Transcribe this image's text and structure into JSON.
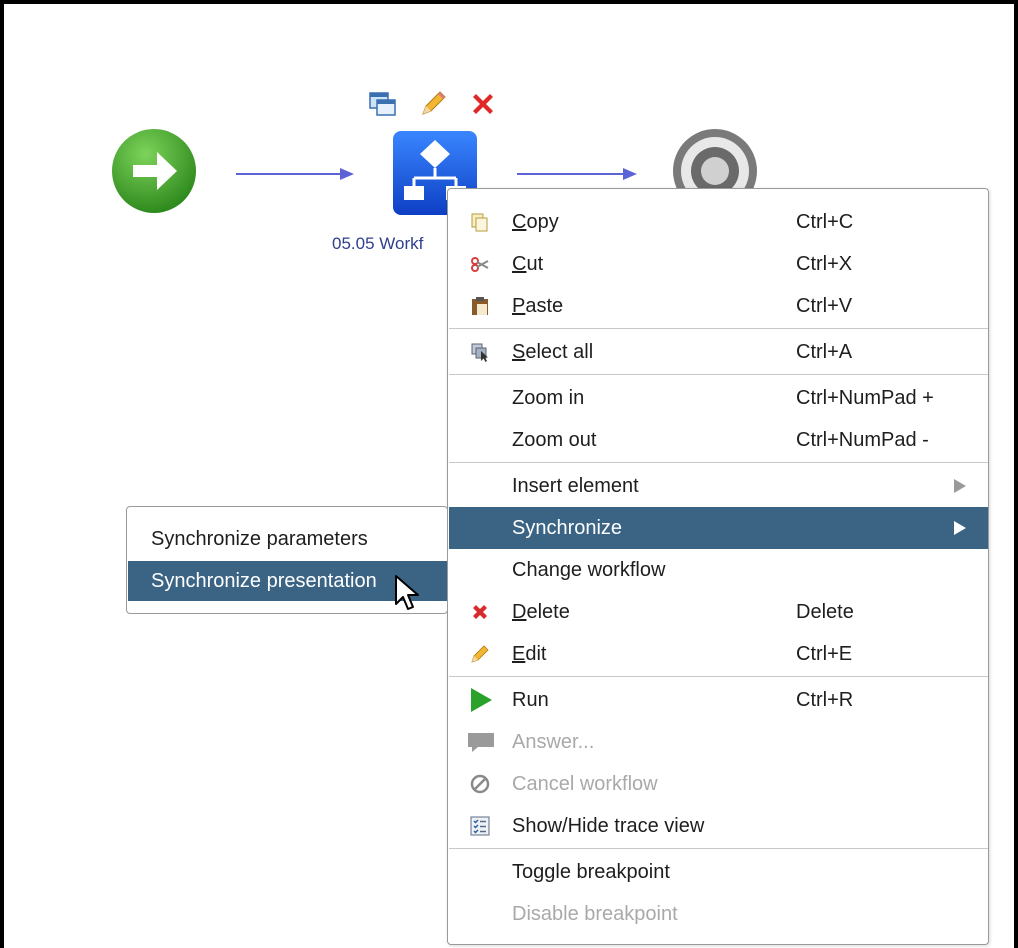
{
  "canvas": {
    "workflow_label": "05.05 Workf"
  },
  "node_toolbar": {
    "icons": [
      "properties-icon",
      "edit-pencil-icon",
      "delete-x-icon"
    ]
  },
  "context_menu": {
    "items": [
      {
        "label": "Copy",
        "mnemonic": "C",
        "rest": "opy",
        "shortcut": "Ctrl+C",
        "icon": "copy-icon"
      },
      {
        "label": "Cut",
        "mnemonic": "C",
        "rest": "ut",
        "shortcut": "Ctrl+X",
        "icon": "scissors-icon"
      },
      {
        "label": "Paste",
        "mnemonic": "P",
        "rest": "aste",
        "shortcut": "Ctrl+V",
        "icon": "paste-icon"
      },
      {
        "label": "Select all",
        "mnemonic": "S",
        "rest": "elect all",
        "shortcut": "Ctrl+A",
        "icon": "select-all-icon"
      },
      {
        "label": "Zoom in",
        "shortcut": "Ctrl+NumPad +"
      },
      {
        "label": "Zoom out",
        "shortcut": "Ctrl+NumPad -"
      },
      {
        "label": "Insert element"
      },
      {
        "label": "Synchronize"
      },
      {
        "label": "Change workflow"
      },
      {
        "label": "Delete",
        "mnemonic": "D",
        "rest": "elete",
        "shortcut": "Delete",
        "icon": "delete-x-icon"
      },
      {
        "label": "Edit",
        "mnemonic": "E",
        "rest": "dit",
        "shortcut": "Ctrl+E",
        "icon": "pencil-icon"
      },
      {
        "label": "Run",
        "shortcut": "Ctrl+R",
        "icon": "run-play-icon"
      },
      {
        "label": "Answer...",
        "icon": "speech-bubble-icon"
      },
      {
        "label": "Cancel workflow",
        "icon": "cancel-circle-icon"
      },
      {
        "label": "Show/Hide trace view",
        "icon": "checklist-icon"
      },
      {
        "label": "Toggle breakpoint"
      },
      {
        "label": "Disable breakpoint"
      }
    ],
    "highlighted": "Synchronize"
  },
  "submenu": {
    "items": [
      {
        "label": "Synchronize parameters"
      },
      {
        "label": "Synchronize presentation"
      }
    ],
    "highlighted": "Synchronize presentation"
  },
  "colors": {
    "highlight": "#3b6484",
    "disabled_text": "#a9a9a9",
    "arrow": "#5b63d6",
    "workflow_node": "#1f5fe0",
    "start_node": "#3f9e2b"
  }
}
